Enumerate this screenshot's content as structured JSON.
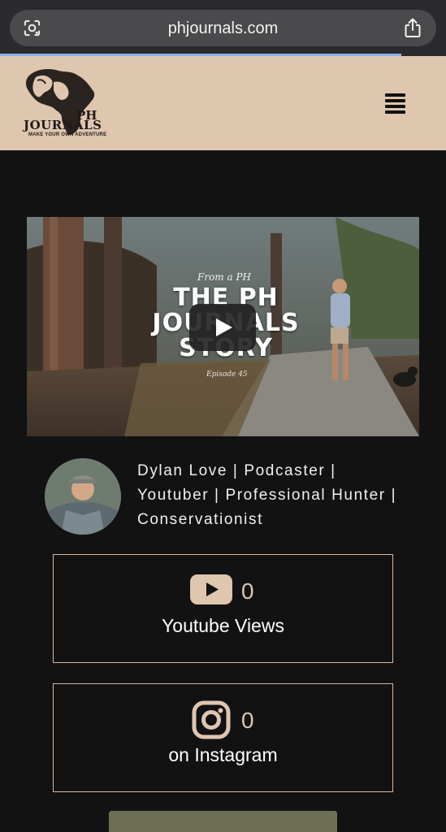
{
  "browser": {
    "url": "phjournals.com",
    "load_progress": 0.9,
    "lens_icon": "lens-icon",
    "share_icon": "share-icon"
  },
  "header": {
    "logo_text": "PH",
    "logo_text_2": "JOURNALS",
    "logo_tagline": "MAKE YOUR OWN ADVENTURE",
    "menu_icon": "hamburger-menu-icon",
    "background": "#dfc6af"
  },
  "video": {
    "pretitle": "From a PH",
    "title": "THE PH JOURNALS STORY",
    "episode": "Episode 45",
    "play_icon": "play-icon"
  },
  "profile": {
    "bio": "Dylan Love | Podcaster | Youtuber | Professional Hunter | Conservationist"
  },
  "stats": [
    {
      "icon": "youtube-icon",
      "count": "0",
      "label": "Youtube Views"
    },
    {
      "icon": "instagram-icon",
      "count": "0",
      "label": "on Instagram"
    }
  ],
  "colors": {
    "accent": "#dfc6af",
    "box_border": "#d9b99a",
    "button": "#6d6f55",
    "background": "#121212"
  }
}
